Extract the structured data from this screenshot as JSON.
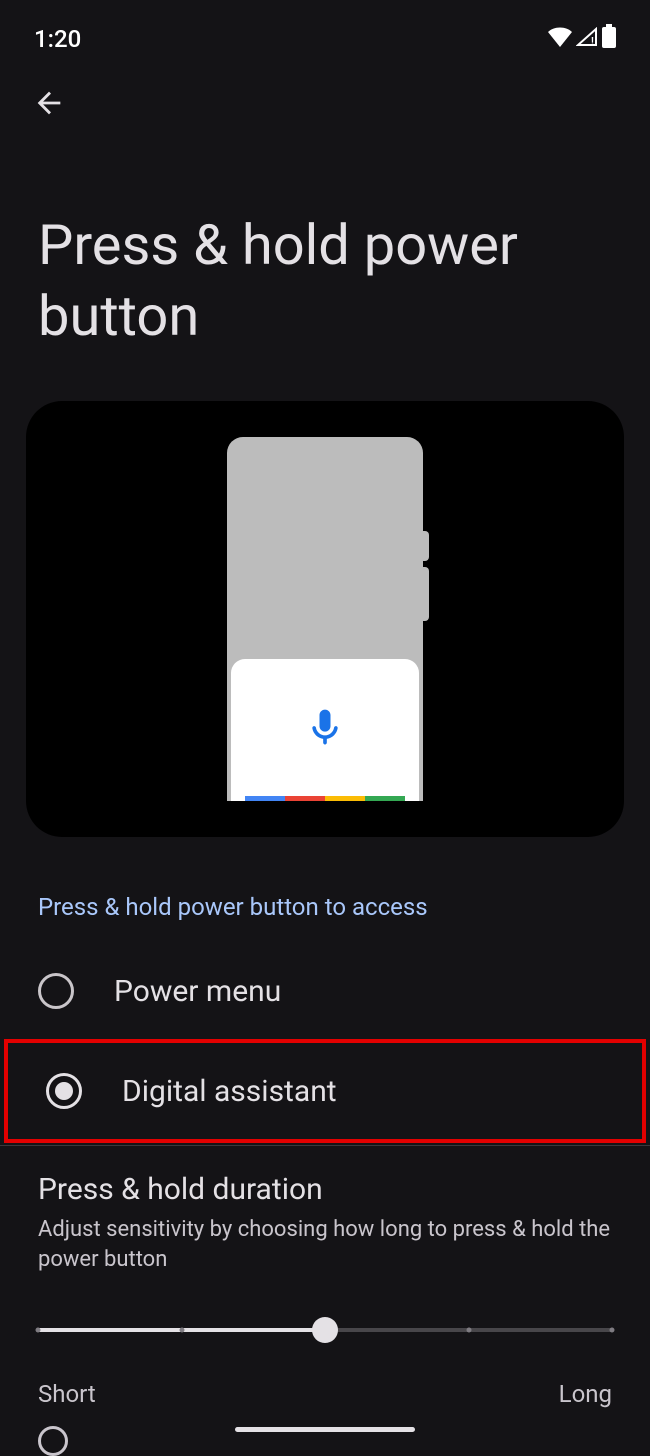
{
  "status": {
    "time": "1:20"
  },
  "page": {
    "title": "Press & hold power button"
  },
  "section_label": "Press & hold power button to access",
  "options": [
    {
      "label": "Power menu",
      "selected": false
    },
    {
      "label": "Digital assistant",
      "selected": true
    }
  ],
  "duration": {
    "title": "Press & hold duration",
    "description": "Adjust sensitivity by choosing how long to press & hold the power button",
    "min_label": "Short",
    "max_label": "Long",
    "value": 0.5
  }
}
